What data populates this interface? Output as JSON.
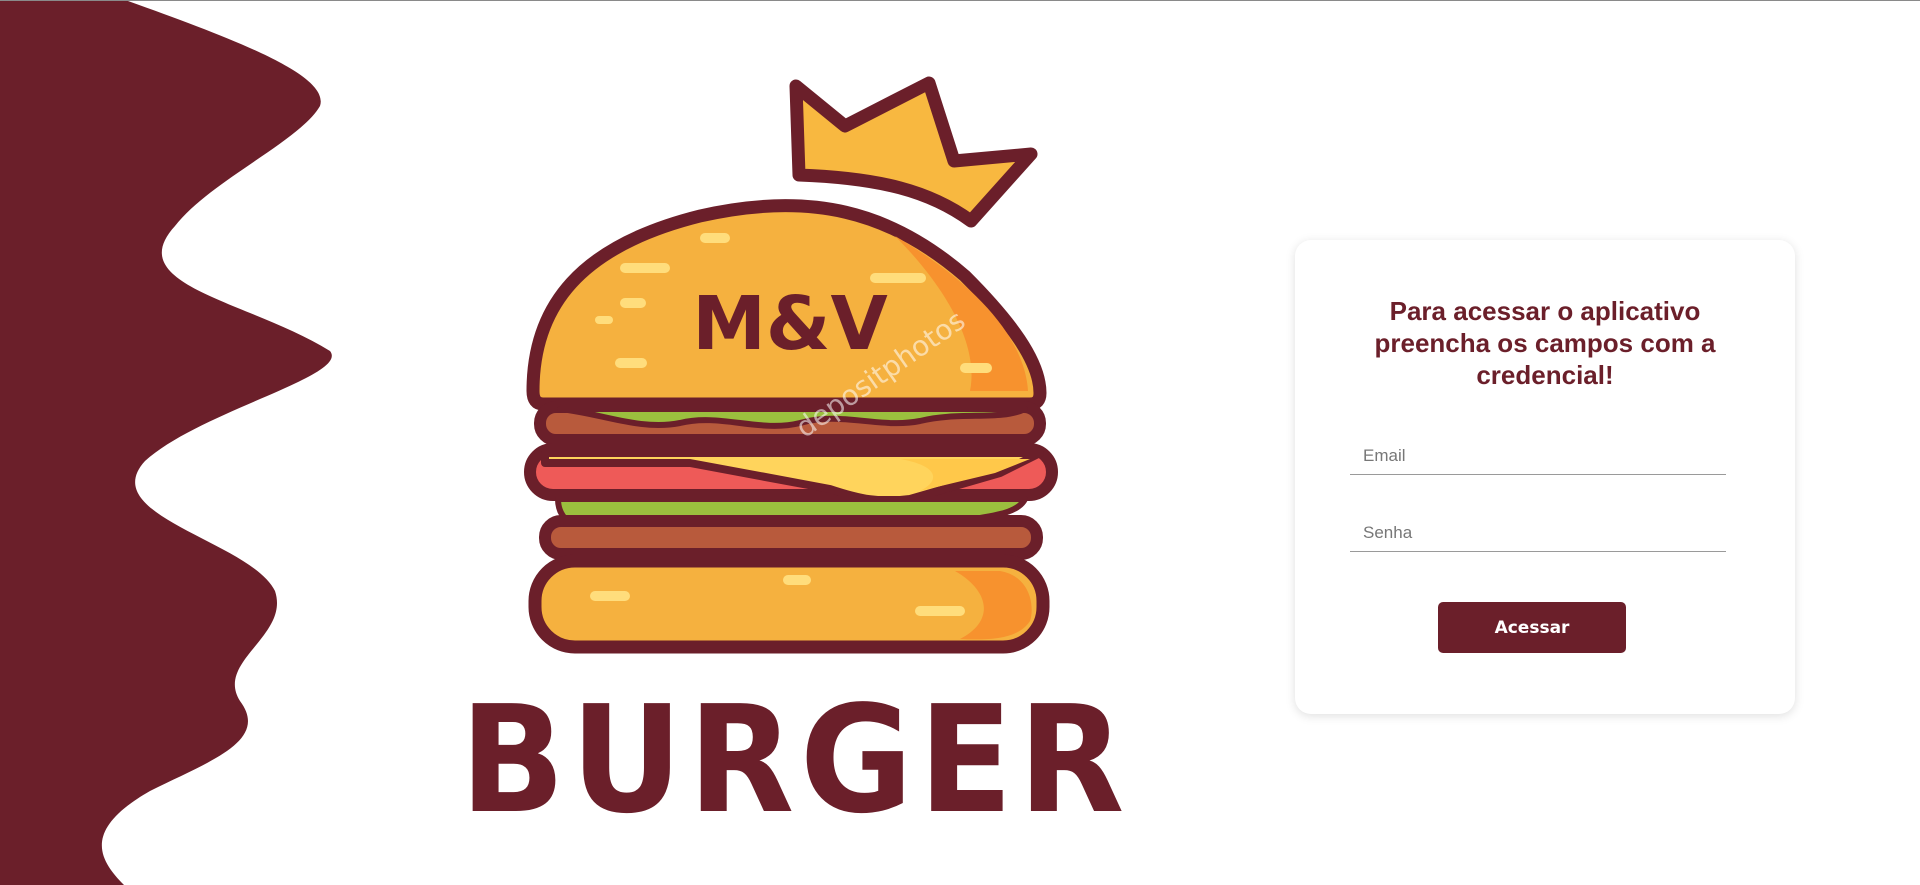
{
  "brand": {
    "logo_top": "M&V",
    "logo_bottom": "BURGER",
    "watermark": "depositphotos",
    "colors": {
      "primary": "#6b1f2a",
      "bun": "#f5b13f",
      "bun_shade": "#f7922e",
      "lettuce": "#9bbf3e",
      "tomato": "#ee5a58",
      "cheese": "#ffd45c",
      "patty": "#b85a3c",
      "crown": "#f8b840"
    }
  },
  "login": {
    "title": "Para acessar o aplicativo preencha os campos com a credencial!",
    "email": {
      "placeholder": "Email",
      "value": ""
    },
    "password": {
      "placeholder": "Senha",
      "value": ""
    },
    "submit_label": "Acessar"
  },
  "icons": {
    "logo": "burger-crown-logo",
    "wave": "wave-decoration"
  }
}
